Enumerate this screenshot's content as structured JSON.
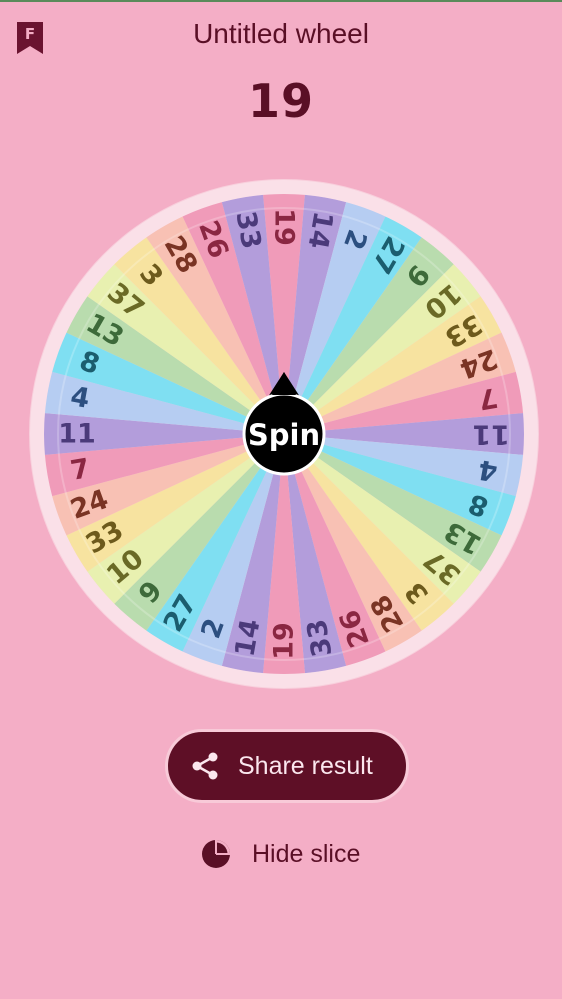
{
  "header": {
    "title": "Untitled wheel",
    "result": "19",
    "logo_icon": "bookmark-f-icon"
  },
  "wheel": {
    "center_label": "Spin",
    "slices": [
      {
        "label": "19",
        "color": "#f09bb9"
      },
      {
        "label": "14",
        "color": "#b39ddb"
      },
      {
        "label": "2",
        "color": "#b6cdf2"
      },
      {
        "label": "27",
        "color": "#7fdff2"
      },
      {
        "label": "9",
        "color": "#b9dcae"
      },
      {
        "label": "10",
        "color": "#e8f0b0"
      },
      {
        "label": "33",
        "color": "#f7e3a0"
      },
      {
        "label": "24",
        "color": "#f8c1b4"
      },
      {
        "label": "7",
        "color": "#f09bb9"
      },
      {
        "label": "11",
        "color": "#b39ddb"
      },
      {
        "label": "4",
        "color": "#b6cdf2"
      },
      {
        "label": "8",
        "color": "#7fdff2"
      },
      {
        "label": "13",
        "color": "#b9dcae"
      },
      {
        "label": "37",
        "color": "#e8f0b0"
      },
      {
        "label": "3",
        "color": "#f7e3a0"
      },
      {
        "label": "28",
        "color": "#f8c1b4"
      },
      {
        "label": "26",
        "color": "#f09bb9"
      },
      {
        "label": "33",
        "color": "#b39ddb"
      },
      {
        "label": "19",
        "color": "#f09bb9"
      },
      {
        "label": "14",
        "color": "#b39ddb"
      },
      {
        "label": "2",
        "color": "#b6cdf2"
      },
      {
        "label": "27",
        "color": "#7fdff2"
      },
      {
        "label": "9",
        "color": "#b9dcae"
      },
      {
        "label": "10",
        "color": "#e8f0b0"
      },
      {
        "label": "33",
        "color": "#f7e3a0"
      },
      {
        "label": "24",
        "color": "#f8c1b4"
      },
      {
        "label": "7",
        "color": "#f09bb9"
      },
      {
        "label": "11",
        "color": "#b39ddb"
      },
      {
        "label": "4",
        "color": "#b6cdf2"
      },
      {
        "label": "8",
        "color": "#7fdff2"
      },
      {
        "label": "13",
        "color": "#b9dcae"
      },
      {
        "label": "37",
        "color": "#e8f0b0"
      },
      {
        "label": "3",
        "color": "#f7e3a0"
      },
      {
        "label": "28",
        "color": "#f8c1b4"
      },
      {
        "label": "26",
        "color": "#f09bb9"
      },
      {
        "label": "33",
        "color": "#b39ddb"
      }
    ]
  },
  "actions": {
    "share_label": "Share result",
    "share_icon": "share-icon",
    "hide_label": "Hide slice",
    "hide_icon": "pie-chart-icon"
  },
  "colors": {
    "background": "#f4aec6",
    "accent": "#5e0f26"
  }
}
